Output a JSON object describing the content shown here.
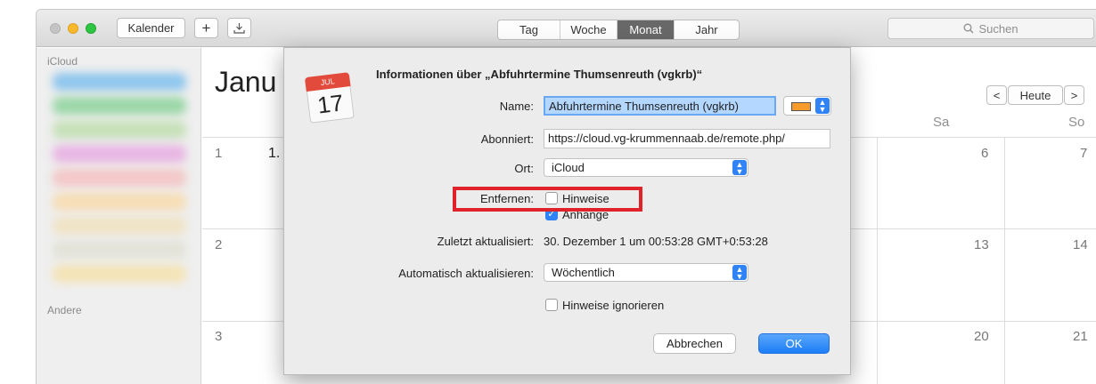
{
  "toolbar": {
    "calendars_label": "Kalender",
    "add_label": "+",
    "views": [
      "Tag",
      "Woche",
      "Monat",
      "Jahr"
    ],
    "search_placeholder": "Suchen"
  },
  "sidebar": {
    "section_icloud": "iCloud",
    "section_other": "Andere"
  },
  "calendar": {
    "month_title": "Janu",
    "today_label": "Heute",
    "prev_label": "<",
    "next_label": ">",
    "day_names": [
      "Sa",
      "So"
    ],
    "week_numbers": [
      "1",
      "2",
      "3"
    ],
    "first_day": "1.",
    "days": {
      "r1": [
        "6",
        "7"
      ],
      "r2": [
        "13",
        "14"
      ],
      "r3": [
        "20",
        "21"
      ]
    }
  },
  "dialog": {
    "icon_month": "JUL",
    "icon_day": "17",
    "title": "Informationen über „Abfuhrtermine Thumsenreuth (vgkrb)“",
    "name_label": "Name:",
    "name_value": "Abfuhrtermine Thumsenreuth (vgkrb)",
    "subscribed_label": "Abonniert:",
    "subscribed_value": "https://cloud.vg-krummennaab.de/remote.php/",
    "location_label": "Ort:",
    "location_value": "iCloud",
    "remove_label": "Entfernen:",
    "remove_alerts_label": "Hinweise",
    "remove_attachments_label": "Anhänge",
    "last_updated_label": "Zuletzt aktualisiert:",
    "last_updated_value": "30. Dezember 1 um 00:53:28 GMT+0:53:28",
    "auto_refresh_label": "Automatisch aktualisieren:",
    "auto_refresh_value": "Wöchentlich",
    "ignore_alerts_label": "Hinweise ignorieren",
    "cancel_label": "Abbrechen",
    "ok_label": "OK",
    "color": "#f79c2c",
    "accent": "#2f83f7",
    "highlight_color": "#e0232a"
  }
}
